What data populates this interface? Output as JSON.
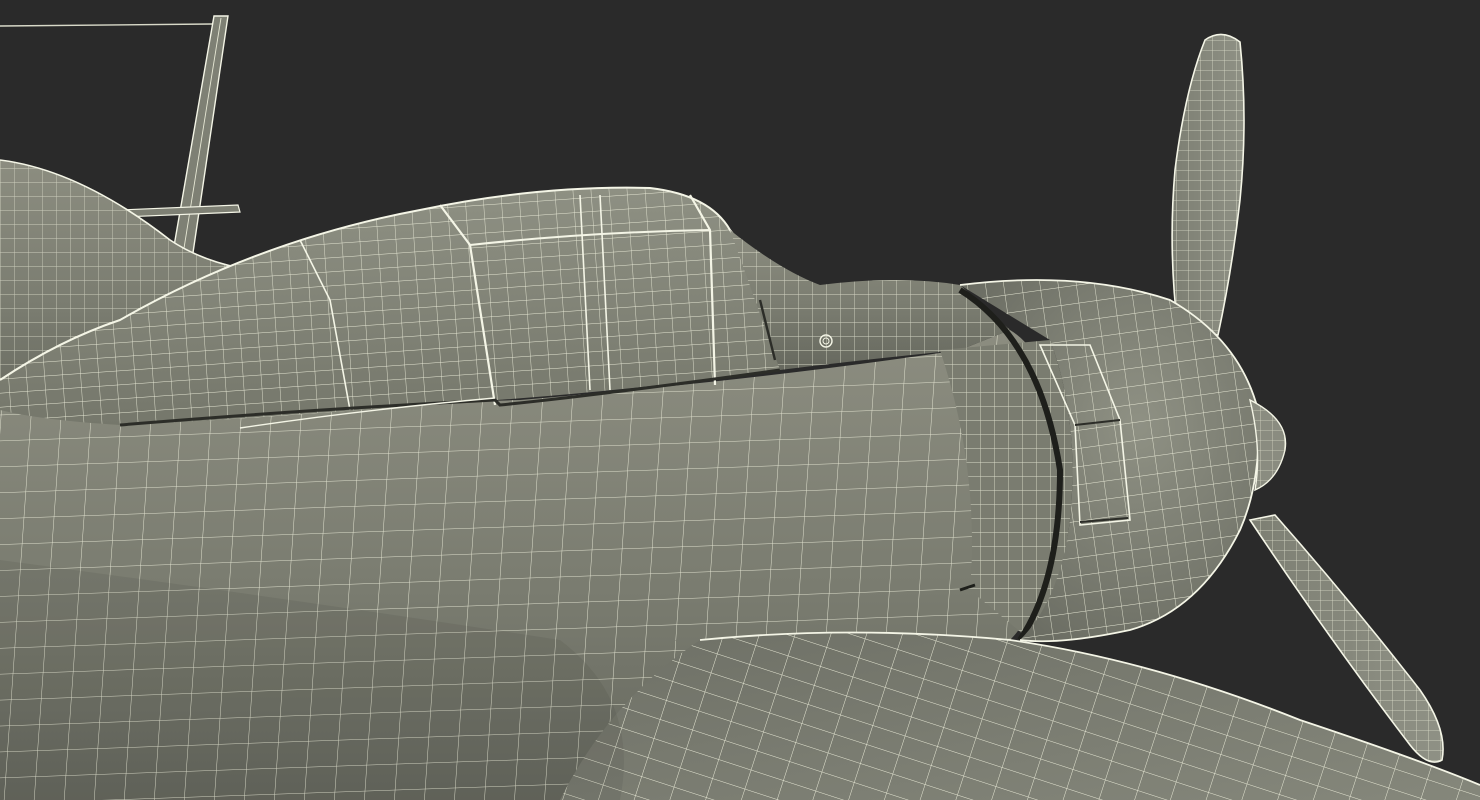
{
  "scene": {
    "subject": "wireframe-aircraft-model",
    "render_style": "wireframe-over-shaded",
    "colors": {
      "background": "#2a2a2a",
      "surface_light": "#8a8b7d",
      "surface_mid": "#74766a",
      "surface_dark": "#5b5d53",
      "wire": "#e6e7d4",
      "wire_strong": "#f4f5e6",
      "shadow": "#1a1a1a"
    }
  }
}
